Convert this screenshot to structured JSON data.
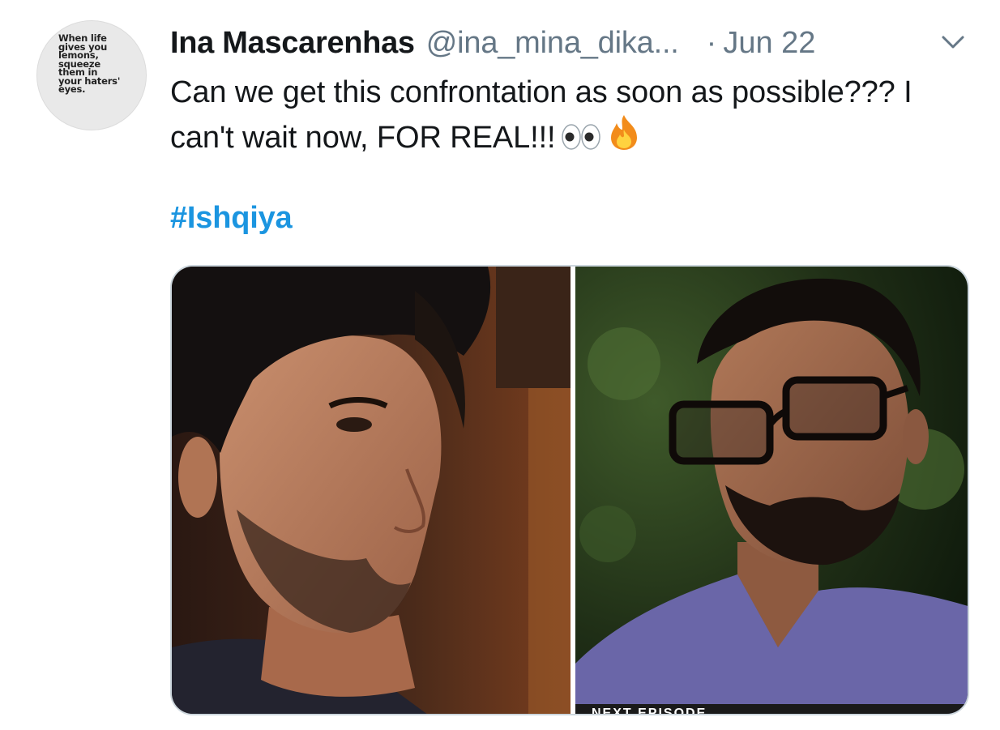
{
  "tweet": {
    "avatar_caption": "When life\ngives you\nlemons,\nsqueeze\nthem in\nyour haters'\neyes.",
    "display_name": "Ina Mascarenhas",
    "handle": "@ina_mina_dika...",
    "separator": "·",
    "date": "Jun 22",
    "text": "Can we get this confrontation as soon as possible??? I can't wait now, FOR REAL!!!",
    "emojis": [
      "eyes-emoji",
      "fire-emoji"
    ],
    "hashtag": "#Ishqiya",
    "media_overlay_text": "NEXT EPISODE"
  },
  "colors": {
    "name": "#14171a",
    "secondary": "#657786",
    "hashtag": "#1b95e0",
    "media_border": "#ccd6dd"
  },
  "icons": {
    "menu": "chevron-down-icon"
  }
}
